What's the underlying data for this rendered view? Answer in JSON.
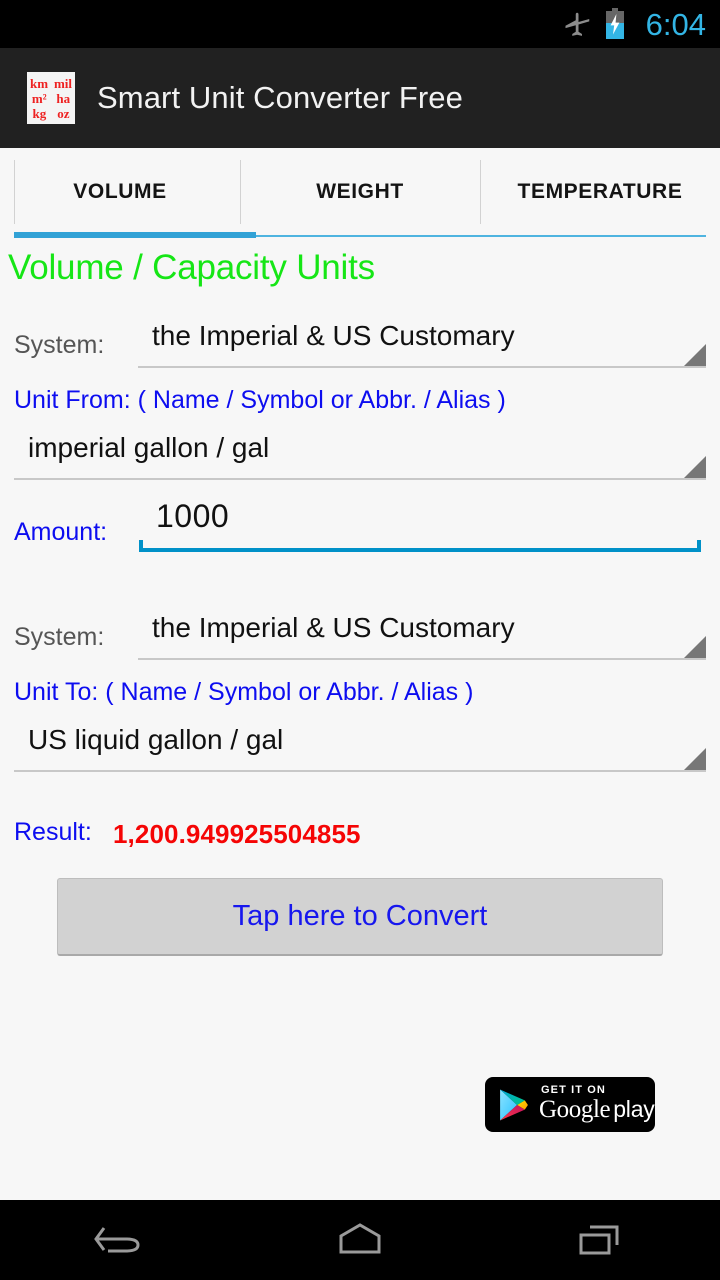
{
  "status_bar": {
    "time": "6:04",
    "icons": [
      "airplane-mode-icon",
      "battery-charging-icon"
    ],
    "clock_color": "#33b5e5",
    "background": "#000000"
  },
  "action_bar": {
    "title": "Smart Unit Converter Free",
    "background": "#212121",
    "app_icon": {
      "name": "app-logo-icon",
      "rows": [
        [
          "km",
          "mil"
        ],
        [
          "m²",
          "ha"
        ],
        [
          "kg",
          "oz"
        ]
      ],
      "text_color": "#ee2222",
      "background": "#f4f4f4"
    }
  },
  "tabs": {
    "items": [
      {
        "label": "VOLUME",
        "selected": true
      },
      {
        "label": "WEIGHT",
        "selected": false
      },
      {
        "label": "TEMPERATURE",
        "selected": false
      }
    ],
    "indicator_color": "#32a2d6",
    "rule_color": "#4fb4e0"
  },
  "main": {
    "section_title": "Volume / Capacity Units",
    "section_title_color": "#16e616",
    "from": {
      "system_label": "System:",
      "system_value": "the Imperial & US Customary",
      "unit_label": "Unit From: ( Name / Symbol or Abbr. / Alias )",
      "unit_value": "imperial gallon / gal"
    },
    "amount": {
      "label": "Amount:",
      "value": "1000",
      "placeholder": "0",
      "underline_color": "#0091c8"
    },
    "to": {
      "system_label": "System:",
      "system_value": "the Imperial & US Customary",
      "unit_label": "Unit To: ( Name / Symbol or Abbr. / Alias )",
      "unit_value": "US liquid gallon / gal"
    },
    "result": {
      "label": "Result:",
      "value": "1,200.949925504855",
      "label_color": "#0d0df0",
      "value_color": "#f50505"
    },
    "convert_button": {
      "label": "Tap here to Convert",
      "text_color": "#1717ee",
      "background": "#d2d2d2"
    },
    "play_badge": {
      "tagline": "GET IT ON",
      "brand": "Google",
      "product": "play"
    }
  },
  "nav_bar": {
    "buttons": [
      {
        "name": "back-icon"
      },
      {
        "name": "home-icon"
      },
      {
        "name": "recents-icon"
      }
    ],
    "background": "#000000",
    "icon_color": "#9a9a9a"
  }
}
